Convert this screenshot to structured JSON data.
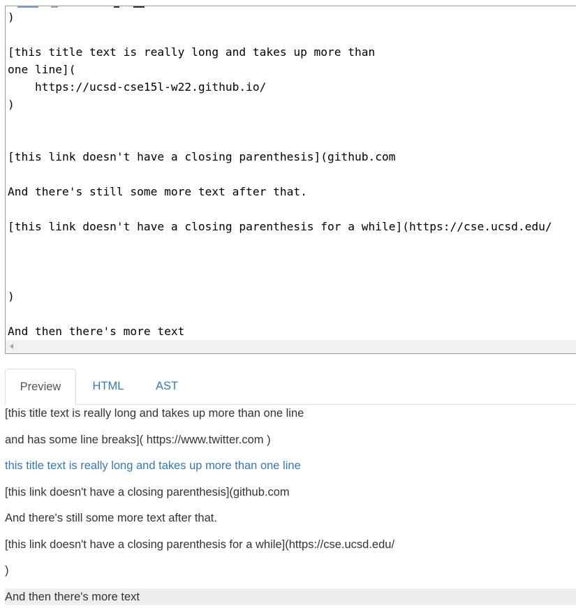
{
  "editor": {
    "lines": [
      ")",
      "",
      "[this title text is really long and takes up more than",
      "one line](",
      "    https://ucsd-cse15l-w22.github.io/",
      ")",
      "",
      "",
      "[this link doesn't have a closing parenthesis](github.com",
      "",
      "And there's still some more text after that.",
      "",
      "[this link doesn't have a closing parenthesis for a while](https://cse.ucsd.edu/",
      "",
      "",
      "",
      ")",
      "",
      "And then there's more text"
    ]
  },
  "tabs": [
    {
      "label": "Preview",
      "active": true
    },
    {
      "label": "HTML",
      "active": false
    },
    {
      "label": "AST",
      "active": false
    }
  ],
  "preview": {
    "lines": [
      "[this title text is really long and takes up more than one line",
      "and has some line breaks]( https://www.twitter.com )",
      "this title text is really long and takes up more than one line",
      "[this link doesn't have a closing parenthesis](github.com",
      "And there's still some more text after that.",
      "[this link doesn't have a closing parenthesis for a while](https://cse.ucsd.edu/",
      ")",
      "And then there's more text"
    ]
  },
  "colors": {
    "link": "#337ab7",
    "text": "#333333",
    "code": "#000000",
    "highlight": "#eeeeee"
  }
}
